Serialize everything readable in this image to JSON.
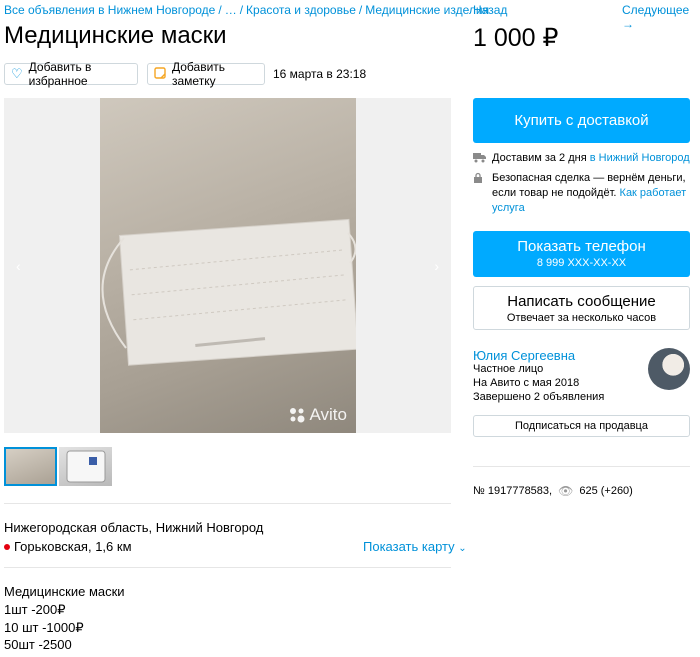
{
  "breadcrumb": [
    "Все объявления в Нижнем Новгороде",
    "…",
    "Красота и здоровье",
    "Медицинские изделия"
  ],
  "title": "Медицинские маски",
  "actions": {
    "favorite": "Добавить в избранное",
    "note": "Добавить заметку",
    "date": "16 марта в 23:18"
  },
  "gallery": {
    "watermark": "Avito",
    "thumbnail_count": 2
  },
  "location": {
    "region": "Нижегородская область, Нижний Новгород",
    "metro": "Горьковская, 1,6 км",
    "show_map": "Показать карту"
  },
  "description": [
    "Медицинские маски",
    "1шт -200₽",
    "10 шт -1000₽",
    "50шт -2500"
  ],
  "nav": {
    "back": "Назад",
    "next": "Следующее →"
  },
  "price": "1 000 ₽",
  "buy": {
    "label": "Купить с доставкой"
  },
  "delivery": {
    "text": "Доставим за 2 дня",
    "city": "в Нижний Новгород"
  },
  "safe_deal": {
    "text": "Безопасная сделка — вернём деньги, если товар не подойдёт.",
    "link": "Как работает услуга"
  },
  "phone": {
    "label": "Показать телефон",
    "number": "8 999 XXX-XX-XX"
  },
  "message": {
    "label": "Написать сообщение",
    "sub": "Отвечает за несколько часов"
  },
  "seller": {
    "name": "Юлия Сергеевна",
    "type": "Частное лицо",
    "since": "На Авито с мая 2018",
    "completed": "Завершено 2 объявления",
    "subscribe": "Подписаться на продавца"
  },
  "meta": {
    "id": "№ 1917778583,",
    "views": "625 (+260)"
  },
  "colors": {
    "accent": "#00aaff",
    "link": "#0091d9",
    "metro": "#e3000f"
  }
}
